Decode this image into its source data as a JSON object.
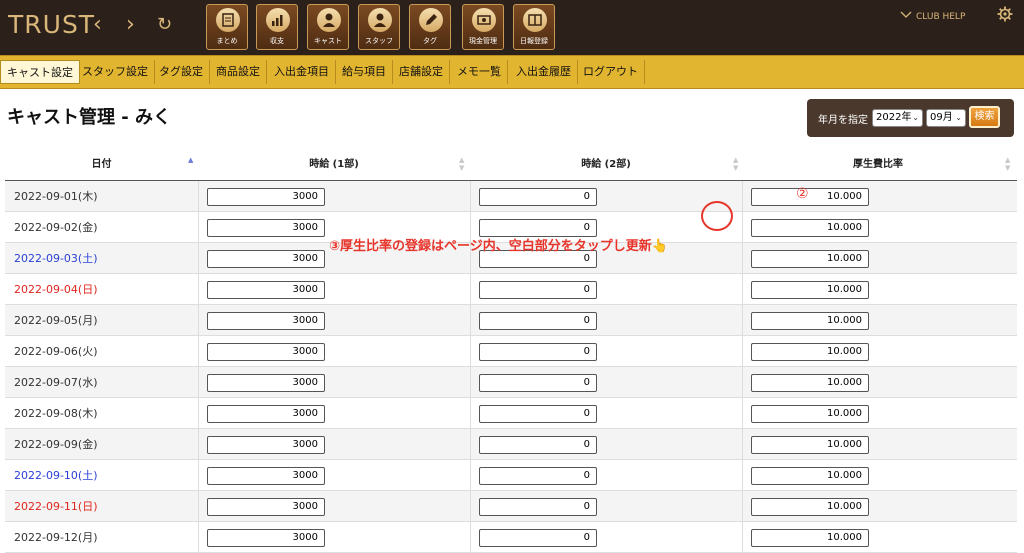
{
  "app": {
    "logo": "TRUST",
    "club_help": "CLUB HELP",
    "nav": {
      "back": "‹",
      "forward": "›",
      "reload": "↻"
    }
  },
  "toolbar": [
    {
      "label": "まとめ",
      "icon": "clipboard-icon"
    },
    {
      "label": "収支",
      "icon": "bar-chart-icon"
    },
    {
      "label": "キャスト",
      "icon": "person-icon"
    },
    {
      "label": "スタッフ",
      "icon": "person-icon"
    },
    {
      "label": "タグ",
      "icon": "pencil-tag-icon"
    },
    {
      "label": "現金管理",
      "icon": "cash-icon"
    },
    {
      "label": "日報登録",
      "icon": "book-icon"
    }
  ],
  "tabs": [
    {
      "label": "キャスト設定",
      "active": true
    },
    {
      "label": "スタッフ設定"
    },
    {
      "label": "タグ設定"
    },
    {
      "label": "商品設定"
    },
    {
      "label": "入出金項目"
    },
    {
      "label": "給与項目"
    },
    {
      "label": "店舗設定"
    },
    {
      "label": "メモ一覧"
    },
    {
      "label": "入出金履歴"
    },
    {
      "label": "ログアウト"
    }
  ],
  "page": {
    "title": "キャスト管理 - みく"
  },
  "search": {
    "label": "年月を指定",
    "year": "2022年",
    "month": "09月",
    "button": "検索"
  },
  "table": {
    "headers": {
      "date": "日付",
      "wage1": "時給 (1部)",
      "wage2": "時給 (2部)",
      "ratio": "厚生費比率"
    },
    "rows": [
      {
        "date": "2022-09-01(木)",
        "day": "weekday",
        "wage1": "3000",
        "wage2": "0",
        "ratio": "10.000"
      },
      {
        "date": "2022-09-02(金)",
        "day": "weekday",
        "wage1": "3000",
        "wage2": "0",
        "ratio": "10.000"
      },
      {
        "date": "2022-09-03(土)",
        "day": "sat",
        "wage1": "3000",
        "wage2": "0",
        "ratio": "10.000"
      },
      {
        "date": "2022-09-04(日)",
        "day": "sun",
        "wage1": "3000",
        "wage2": "0",
        "ratio": "10.000"
      },
      {
        "date": "2022-09-05(月)",
        "day": "weekday",
        "wage1": "3000",
        "wage2": "0",
        "ratio": "10.000"
      },
      {
        "date": "2022-09-06(火)",
        "day": "weekday",
        "wage1": "3000",
        "wage2": "0",
        "ratio": "10.000"
      },
      {
        "date": "2022-09-07(水)",
        "day": "weekday",
        "wage1": "3000",
        "wage2": "0",
        "ratio": "10.000"
      },
      {
        "date": "2022-09-08(木)",
        "day": "weekday",
        "wage1": "3000",
        "wage2": "0",
        "ratio": "10.000"
      },
      {
        "date": "2022-09-09(金)",
        "day": "weekday",
        "wage1": "3000",
        "wage2": "0",
        "ratio": "10.000"
      },
      {
        "date": "2022-09-10(土)",
        "day": "sat",
        "wage1": "3000",
        "wage2": "0",
        "ratio": "10.000"
      },
      {
        "date": "2022-09-11(日)",
        "day": "sun",
        "wage1": "3000",
        "wage2": "0",
        "ratio": "10.000"
      },
      {
        "date": "2022-09-12(月)",
        "day": "weekday",
        "wage1": "3000",
        "wage2": "0",
        "ratio": "10.000"
      }
    ]
  },
  "annotations": {
    "step2": "②",
    "step3": "③厚生比率の登録はページ内、空白部分をタップし更新👆"
  },
  "colors": {
    "topbar": "#2b201a",
    "gold": "#e2b530",
    "accent_red": "#e8352b",
    "saturday": "#2a3fd6",
    "sunday": "#e0261e"
  }
}
